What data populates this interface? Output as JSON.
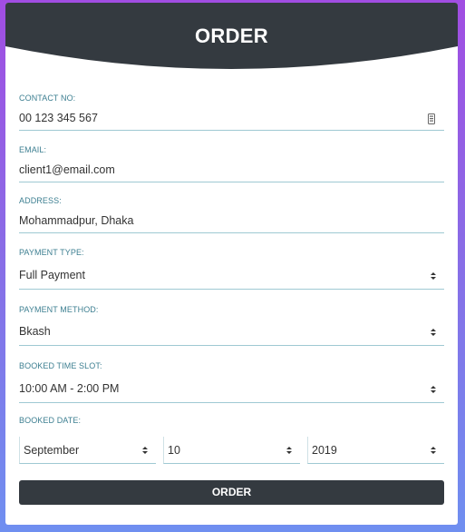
{
  "header": {
    "title": "ORDER"
  },
  "form": {
    "contact": {
      "label": "CONTACT NO:",
      "value": "00 123 345 567"
    },
    "email": {
      "label": "EMAIL:",
      "value": "client1@email.com"
    },
    "address": {
      "label": "ADDRESS:",
      "value": "Mohammadpur, Dhaka"
    },
    "payment_type": {
      "label": "PAYMENT TYPE:",
      "value": "Full Payment"
    },
    "payment_method": {
      "label": "PAYMENT METHOD:",
      "value": "Bkash"
    },
    "time_slot": {
      "label": "BOOKED TIME SLOT:",
      "value": "10:00 AM - 2:00 PM"
    },
    "date": {
      "label": "BOOKED DATE:",
      "month": "September",
      "day": "10",
      "year": "2019"
    },
    "submit_label": "ORDER"
  },
  "icons": {
    "contact": "phone-icon",
    "select": "select-caret-icon"
  },
  "colors": {
    "header_bg": "#343a40",
    "label": "#3d7f91",
    "underline": "#9fc9d3",
    "button_bg": "#343a40"
  }
}
